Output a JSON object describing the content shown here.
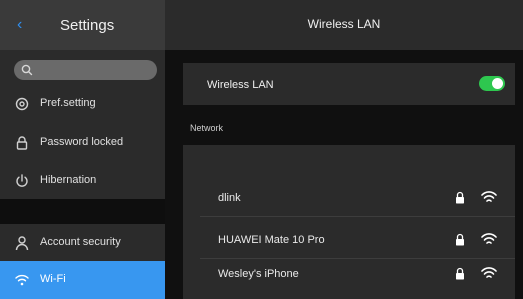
{
  "sidebar": {
    "back_glyph": "‹",
    "title": "Settings",
    "search": {
      "placeholder": ""
    },
    "items": [
      {
        "label": "Pref.setting",
        "icon": "gear-icon"
      },
      {
        "label": "Password locked",
        "icon": "lock-icon"
      },
      {
        "label": "Hibernation",
        "icon": "power-icon"
      },
      {
        "label": "Account security",
        "icon": "person-icon"
      },
      {
        "label": "Wi-Fi",
        "icon": "wifi-icon",
        "active": true
      }
    ]
  },
  "main": {
    "title": "Wireless LAN",
    "wireless_lan": {
      "label": "Wireless LAN",
      "enabled": true
    },
    "network_section_label": "Network",
    "networks": [
      {
        "name": "dlink",
        "secured": true
      },
      {
        "name": "HUAWEI Mate 10 Pro",
        "secured": true
      },
      {
        "name": "Wesley's iPhone",
        "secured": true
      }
    ]
  },
  "colors": {
    "accent": "#3897f0",
    "toggle_on": "#2ec74f",
    "background": "#101010",
    "panel": "#2b2b2b"
  }
}
